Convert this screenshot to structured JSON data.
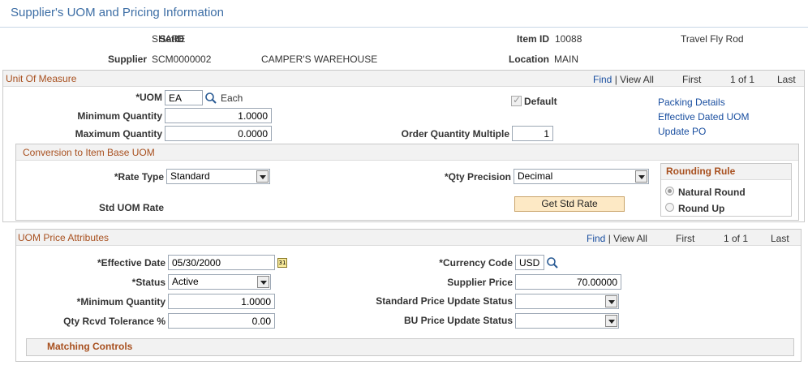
{
  "page_title": "Supplier's UOM and Pricing Information",
  "header": {
    "setid_label": "SetID",
    "setid_value": "SHARE",
    "item_id_label": "Item ID",
    "item_id_value": "10088",
    "item_desc": "Travel Fly Rod",
    "supplier_label": "Supplier",
    "supplier_value": "SCM0000002",
    "supplier_name": "CAMPER'S WAREHOUSE",
    "location_label": "Location",
    "location_value": "MAIN"
  },
  "uom_section": {
    "title": "Unit Of Measure",
    "nav": {
      "find": "Find",
      "sep": "|",
      "view_all": "View All",
      "first": "First",
      "range": "1 of 1",
      "last": "Last"
    },
    "uom_label": "*UOM",
    "uom_value": "EA",
    "uom_desc": "Each",
    "default_label": "Default",
    "min_qty_label": "Minimum Quantity",
    "min_qty_value": "1.0000",
    "max_qty_label": "Maximum Quantity",
    "max_qty_value": "0.0000",
    "order_mult_label": "Order Quantity Multiple",
    "order_mult_value": "1",
    "links": {
      "packing": "Packing Details",
      "eff_dated": "Effective Dated UOM",
      "update_po": "Update PO"
    }
  },
  "conversion": {
    "title": "Conversion to Item Base UOM",
    "rate_type_label": "*Rate Type",
    "rate_type_value": "Standard",
    "qty_precision_label": "*Qty Precision",
    "qty_precision_value": "Decimal",
    "std_uom_rate_label": "Std UOM Rate",
    "get_std_rate_button": "Get Std Rate",
    "rounding_rule_title": "Rounding Rule",
    "natural_round": "Natural Round",
    "round_up": "Round Up"
  },
  "price_section": {
    "title": "UOM Price Attributes",
    "nav": {
      "find": "Find",
      "sep": "|",
      "view_all": "View All",
      "first": "First",
      "range": "1 of 1",
      "last": "Last"
    },
    "eff_date_label": "*Effective Date",
    "eff_date_value": "05/30/2000",
    "currency_label": "*Currency Code",
    "currency_value": "USD",
    "status_label": "*Status",
    "status_value": "Active",
    "supplier_price_label": "Supplier Price",
    "supplier_price_value": "70.00000",
    "min_qty_label": "*Minimum Quantity",
    "min_qty_value": "1.0000",
    "std_price_update_label": "Standard Price Update Status",
    "std_price_update_value": "",
    "qty_rcvd_tol_label": "Qty Rcvd Tolerance %",
    "qty_rcvd_tol_value": "0.00",
    "bu_price_update_label": "BU Price Update Status",
    "bu_price_update_value": "",
    "matching_controls": "Matching Controls"
  },
  "colors": {
    "title_blue": "#3d6ea5",
    "section_orange": "#a8501f",
    "link_blue": "#1a4fa0",
    "button_bg": "#fde9c5"
  },
  "icons": {
    "lookup": "magnifier-icon",
    "calendar": "calendar-icon",
    "dropdown": "chevron-down-icon"
  }
}
